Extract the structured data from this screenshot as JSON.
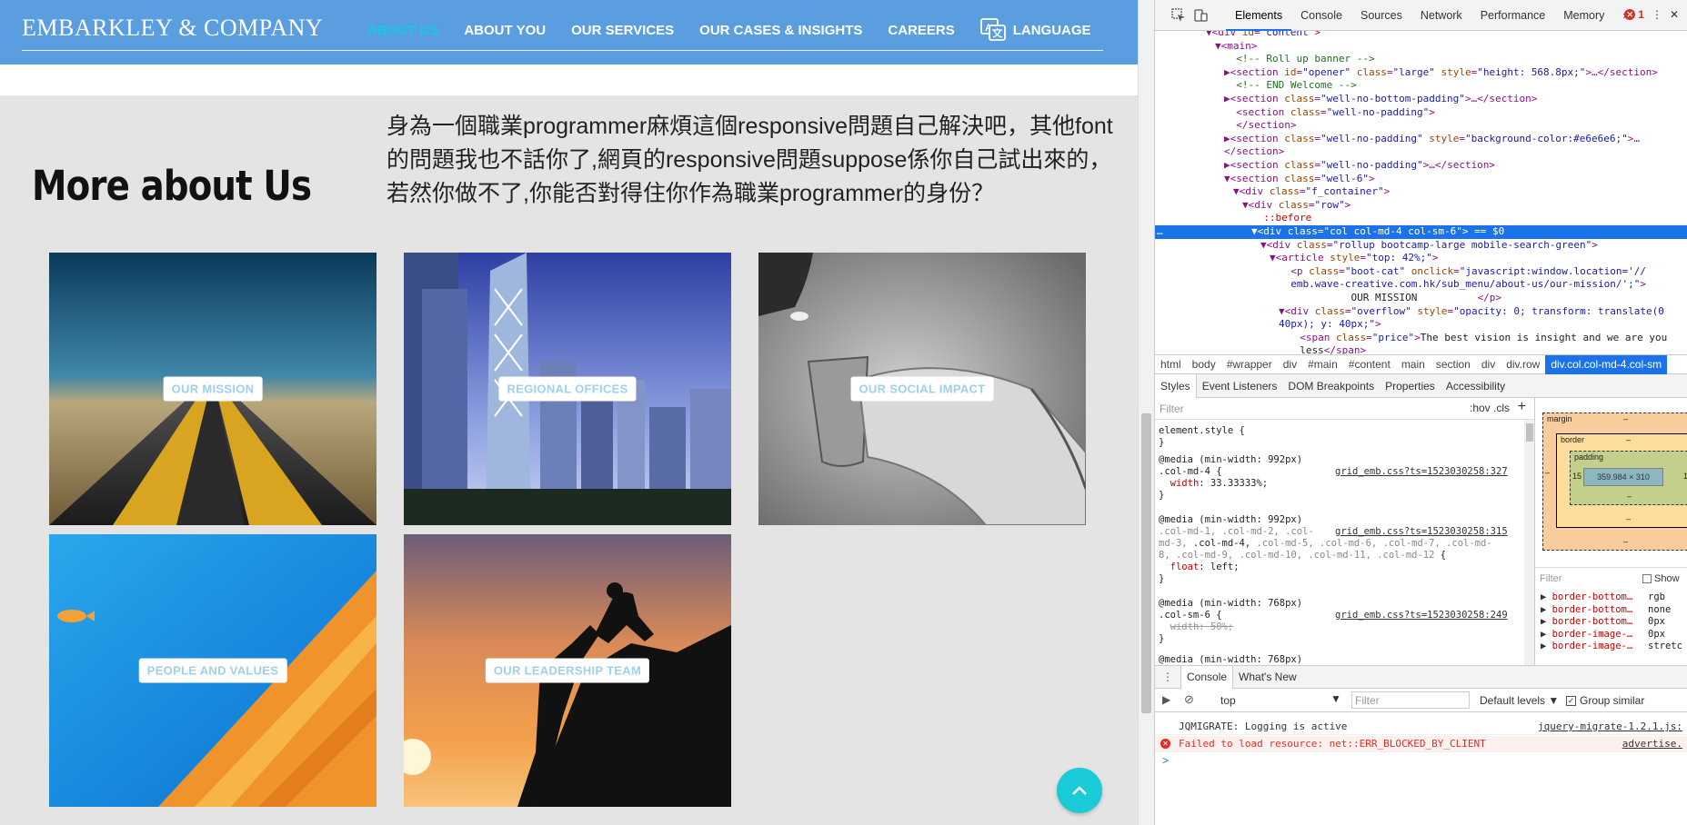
{
  "site": {
    "logo": "EMBARKLEY & COMPANY",
    "nav": [
      {
        "label": "ABOUT US",
        "active": true
      },
      {
        "label": "ABOUT YOU",
        "active": false
      },
      {
        "label": "OUR SERVICES",
        "active": false
      },
      {
        "label": "OUR CASES & INSIGHTS",
        "active": false
      },
      {
        "label": "CAREERS",
        "active": false
      }
    ],
    "language_label": "LANGUAGE",
    "more_title": "More about Us",
    "more_text": "身為一個職業programmer麻煩這個responsive問題自己解決吧，其他font的問題我也不話你了,網頁的responsive問題suppose係你自己試出來的，若然你做不了,你能否對得住你作為職業programmer的身份？",
    "tiles": [
      {
        "label": "OUR MISSION"
      },
      {
        "label": "REGIONAL OFFICES"
      },
      {
        "label": "OUR SOCIAL IMPACT"
      },
      {
        "label": "PEOPLE AND VALUES"
      },
      {
        "label": "OUR LEADERSHIP TEAM"
      }
    ],
    "colors": {
      "nav_bg": "#5b9ee0",
      "active_nav": "#14c8e6",
      "scroll_top": "#19cbd7",
      "page_bg": "#e4e4e4"
    }
  },
  "devtools": {
    "tabs": [
      "Elements",
      "Console",
      "Sources",
      "Network",
      "Performance",
      "Memory",
      "»"
    ],
    "error_count": "1",
    "dom_lines": [
      {
        "indent": 6,
        "html": "▼<span class='tag'>&lt;div</span> <span class='attr'>id</span>=<span class='val'>\"content\"</span><span class='tag'>&gt;</span>"
      },
      {
        "indent": 7,
        "html": "▼<span class='tag'>&lt;main&gt;</span>"
      },
      {
        "indent": 8,
        "html": "  <span class='cmt'>&lt;!-- Roll up banner --&gt;</span>"
      },
      {
        "indent": 8,
        "html": "▶<span class='tag'>&lt;section</span> <span class='attr'>id</span>=<span class='val'>\"opener\"</span> <span class='attr'>class</span>=<span class='val'>\"large\"</span> <span class='attr'>style</span>=<span class='val'>\"height: 568.8px;\"</span><span class='tag'>&gt;</span>…<span class='tag'>&lt;/section&gt;</span>"
      },
      {
        "indent": 8,
        "html": "  <span class='cmt'>&lt;!-- END Welcome --&gt;</span>"
      },
      {
        "indent": 8,
        "html": "▶<span class='tag'>&lt;section</span> <span class='attr'>class</span>=<span class='val'>\"well-no-bottom-padding\"</span><span class='tag'>&gt;</span>…<span class='tag'>&lt;/section&gt;</span>"
      },
      {
        "indent": 8,
        "html": "  <span class='tag'>&lt;section</span> <span class='attr'>class</span>=<span class='val'>\"well-no-padding\"</span><span class='tag'>&gt;</span>"
      },
      {
        "indent": 8,
        "html": "  <span class='tag'>&lt;/section&gt;</span>"
      },
      {
        "indent": 8,
        "html": "▶<span class='tag'>&lt;section</span> <span class='attr'>class</span>=<span class='val'>\"well-no-padding\"</span> <span class='attr'>style</span>=<span class='val'>\"background-color:#e6e6e6;\"</span><span class='tag'>&gt;</span>…"
      },
      {
        "indent": 8,
        "html": "<span class='tag'>&lt;/section&gt;</span>"
      },
      {
        "indent": 8,
        "html": "▶<span class='tag'>&lt;section</span> <span class='attr'>class</span>=<span class='val'>\"well-no-padding\"</span><span class='tag'>&gt;</span>…<span class='tag'>&lt;/section&gt;</span>"
      },
      {
        "indent": 8,
        "html": "▼<span class='tag'>&lt;section</span> <span class='attr'>class</span>=<span class='val'>\"well-6\"</span><span class='tag'>&gt;</span>"
      },
      {
        "indent": 9,
        "html": "▼<span class='tag'>&lt;div</span> <span class='attr'>class</span>=<span class='val'>\"f_container\"</span><span class='tag'>&gt;</span>"
      },
      {
        "indent": 10,
        "html": "▼<span class='tag'>&lt;div</span> <span class='attr'>class</span>=<span class='val'>\"row\"</span><span class='tag'>&gt;</span>"
      },
      {
        "indent": 11,
        "html": "  <span class='pseudo'>::before</span>"
      },
      {
        "indent": 11,
        "html": "▼<span class='tag'>&lt;div</span> <span class='attr'>class</span>=<span class='val'>\"col col-md-4 col-sm-6\"</span><span class='tag'>&gt;</span> == $0",
        "selected": true
      },
      {
        "indent": 12,
        "html": "▼<span class='tag'>&lt;div</span> <span class='attr'>class</span>=<span class='val'>\"rollup bootcamp-large mobile-search-green\"</span><span class='tag'>&gt;</span>"
      },
      {
        "indent": 13,
        "html": "▼<span class='tag'>&lt;article</span> <span class='attr'>style</span>=<span class='val'>\"top: 42%;\"</span><span class='tag'>&gt;</span>"
      },
      {
        "indent": 14,
        "html": "  <span class='tag'>&lt;p</span> <span class='attr'>class</span>=<span class='val'>\"boot-cat\"</span> <span class='attr'>onclick</span>=<span class='val'>\"javascript:window.location='//</span>"
      },
      {
        "indent": 14,
        "html": "  <span class='val'>emb.wave-creative.com.hk/sub_menu/about-us/our-mission/';\"</span><span class='tag'>&gt;</span>"
      },
      {
        "indent": 14,
        "html": "  <span class='txt'>          OUR MISSION</span>          <span class='tag'>&lt;/p&gt;</span>"
      },
      {
        "indent": 14,
        "html": "▼<span class='tag'>&lt;div</span> <span class='attr'>class</span>=<span class='val'>\"overflow\"</span> <span class='attr'>style</span>=<span class='val'>\"opacity: 0; transform: translate(0</span>"
      },
      {
        "indent": 14,
        "html": "<span class='val'>40px); y: 40px;\"</span><span class='tag'>&gt;</span>"
      },
      {
        "indent": 15,
        "html": "  <span class='tag'>&lt;span</span> <span class='attr'>class</span>=<span class='val'>\"price\"</span><span class='tag'>&gt;</span><span class='txt'>The best vision is insight and we are you</span>"
      },
      {
        "indent": 15,
        "html": "  <span class='txt'>less</span><span class='tag'>&lt;/span&gt;</span>"
      }
    ],
    "breadcrumbs": [
      "html",
      "body",
      "#wrapper",
      "div",
      "#main",
      "#content",
      "main",
      "section",
      "div",
      "div.row",
      "div.col.col-md-4.col-sm"
    ],
    "subtabs": [
      "Styles",
      "Event Listeners",
      "DOM Breakpoints",
      "Properties",
      "Accessibility"
    ],
    "styles_filter_placeholder": "Filter",
    "styles_opts": ":hov  .cls",
    "box_model": {
      "margin_label": "margin",
      "border_label": "border",
      "padding_label": "padding",
      "content": "359.984 × 310",
      "padding_lr": "15",
      "dash": "–"
    },
    "computed_filter": "Filter",
    "show_all": "Show",
    "computed": [
      {
        "prop": "border-bottom…",
        "value": "rgb"
      },
      {
        "prop": "border-bottom…",
        "value": "none"
      },
      {
        "prop": "border-bottom…",
        "value": "0px"
      },
      {
        "prop": "border-image-…",
        "value": "0px"
      },
      {
        "prop": "border-image-…",
        "value": "stretc"
      }
    ],
    "console_tabs": [
      "Console",
      "What's New"
    ],
    "console_context": "top",
    "console_filter": "Filter",
    "console_levels": "Default levels ▼",
    "group_similar": "Group similar",
    "messages": [
      {
        "text": "JQMIGRATE: Logging is active",
        "source": "jquery-migrate-1.2.1.js:",
        "type": "log"
      },
      {
        "text": "Failed to load resource: net::ERR_BLOCKED_BY_CLIENT",
        "source": "advertise.",
        "type": "error"
      }
    ],
    "prompt": ">"
  }
}
